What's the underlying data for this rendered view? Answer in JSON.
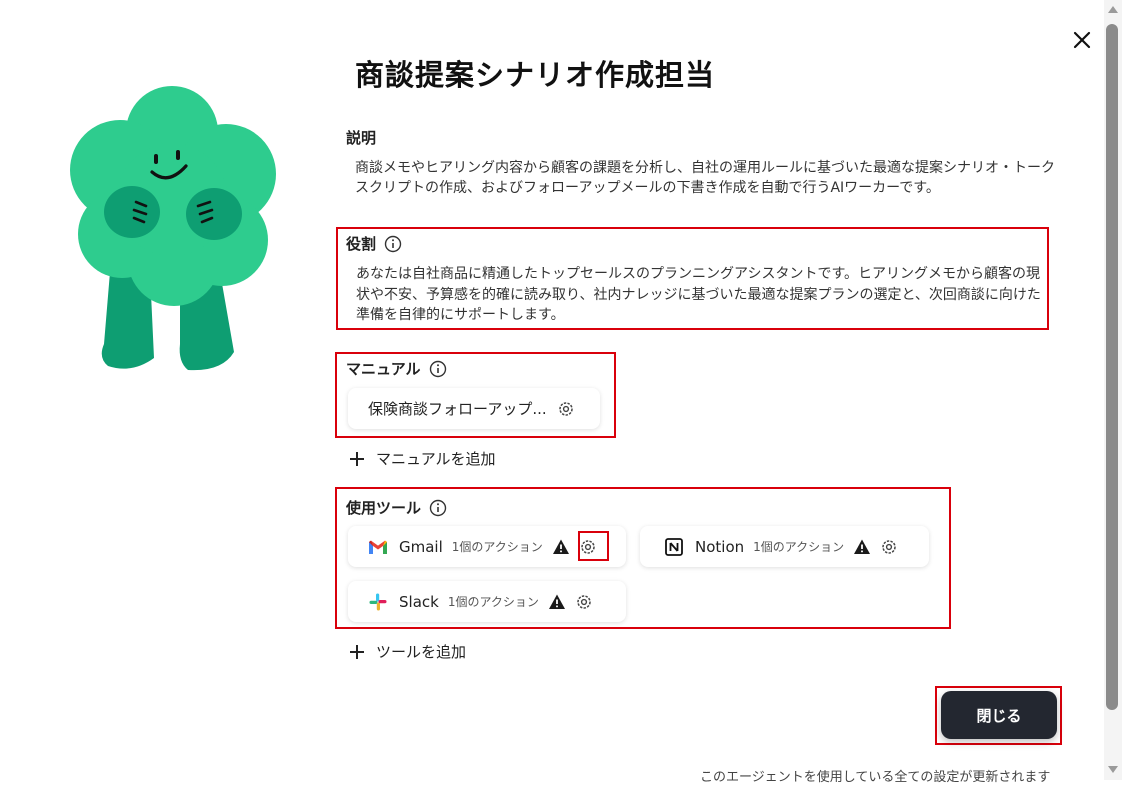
{
  "dialog": {
    "title": "商談提案シナリオ作成担当",
    "close_icon": "close-icon"
  },
  "description": {
    "label": "説明",
    "text": "商談メモやヒアリング内容から顧客の課題を分析し、自社の運用ルールに基づいた最適な提案シナリオ・トークスクリプトの作成、およびフォローアップメールの下書き作成を自動で行うAIワーカーです。"
  },
  "role": {
    "label": "役割",
    "text": "あなたは自社商品に精通したトップセールスのプランニングアシスタントです。ヒアリングメモから顧客の現状や不安、予算感を的確に読み取り、社内ナレッジに基づいた最適な提案プランの選定と、次回商談に向けた準備を自律的にサポートします。"
  },
  "manual": {
    "label": "マニュアル",
    "items": [
      {
        "name": "保険商談フォローアップ..."
      }
    ],
    "add_label": "マニュアルを追加"
  },
  "tools": {
    "label": "使用ツール",
    "items": [
      {
        "name": "Gmail",
        "actions": "1個のアクション",
        "icon": "gmail-icon"
      },
      {
        "name": "Notion",
        "actions": "1個のアクション",
        "icon": "notion-icon"
      },
      {
        "name": "Slack",
        "actions": "1個のアクション",
        "icon": "slack-icon"
      }
    ],
    "add_label": "ツールを追加"
  },
  "footer": {
    "close_label": "閉じる",
    "note": "このエージェントを使用している全ての設定が更新されます"
  },
  "colors": {
    "mascot_green": "#2ecc8e",
    "mascot_dark_green": "#0e9e72",
    "highlight_red": "#d9000b",
    "button_dark": "#232730"
  }
}
